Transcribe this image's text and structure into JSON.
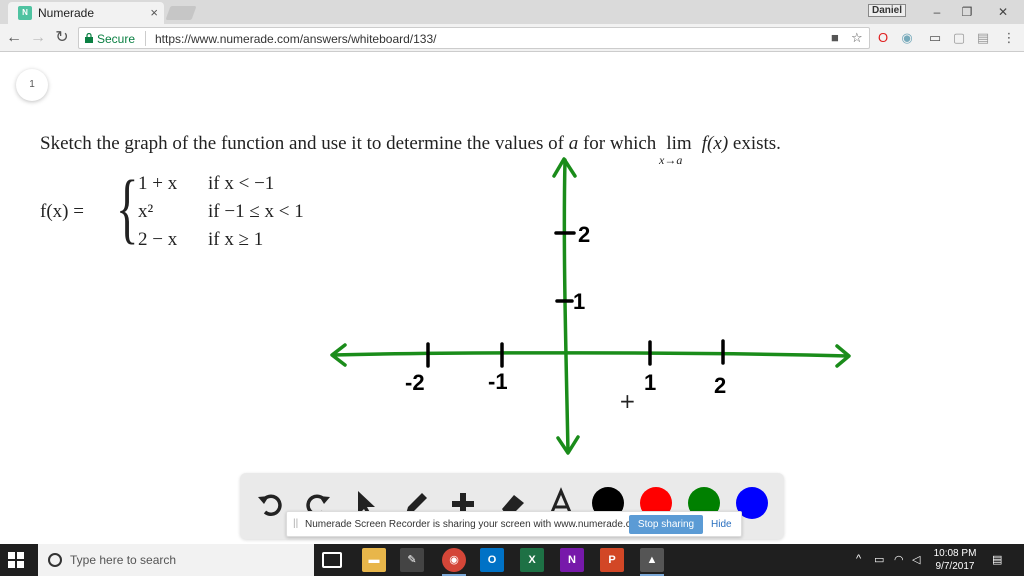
{
  "browser": {
    "tab_title": "Numerade",
    "tab_close": "×",
    "profile_name": "Daniel",
    "secure_label": "Secure",
    "url": "https://www.numerade.com/answers/whiteboard/133/"
  },
  "page": {
    "badge": "1",
    "problem": {
      "text_before": "Sketch the graph of the function and use it to determine the values of ",
      "var_a": "a",
      "text_mid": " for which ",
      "lim_word": "lim",
      "lim_sub": "x→a",
      "fx": "f(x)",
      "text_after": " exists."
    },
    "piecewise": {
      "lhs": "f(x) =",
      "rows": [
        {
          "expr": "1 + x",
          "cond": "if x < −1"
        },
        {
          "expr": "x²",
          "cond": "if −1 ≤ x < 1"
        },
        {
          "expr": "2 − x",
          "cond": "if x ≥ 1"
        }
      ]
    },
    "graph_labels": {
      "x_ticks": [
        "-2",
        "-1",
        "1",
        "2"
      ],
      "y_ticks": [
        "1",
        "2"
      ],
      "cursor": "+"
    }
  },
  "drawbar": {
    "tools": [
      "undo-icon",
      "redo-icon",
      "pointer-icon",
      "pen-icon",
      "add-icon",
      "eraser-icon",
      "text-icon"
    ],
    "colors": [
      "#000000",
      "#ff0000",
      "#008000",
      "#0000ff"
    ]
  },
  "share_bar": {
    "grip": "||",
    "message": "Numerade Screen Recorder is sharing your screen with www.numerade.com.",
    "stop_label": "Stop sharing",
    "hide_label": "Hide"
  },
  "taskbar": {
    "search_placeholder": "Type here to search",
    "time": "10:08 PM",
    "date": "9/7/2017"
  }
}
